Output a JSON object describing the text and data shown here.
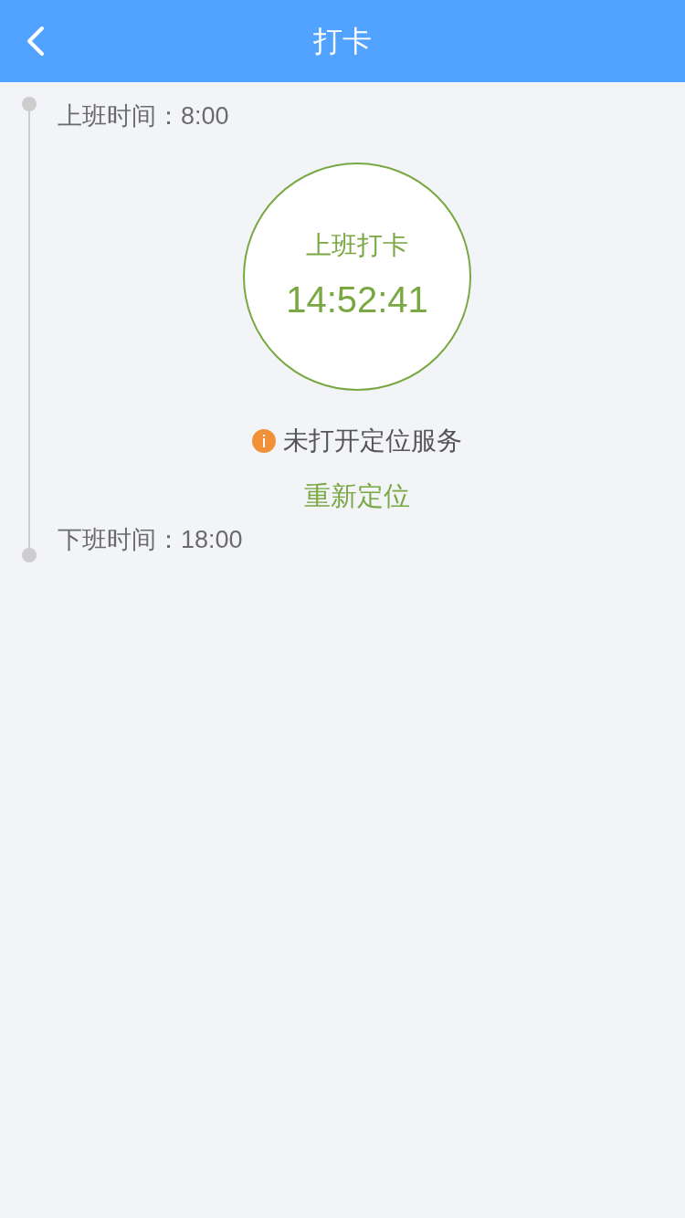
{
  "header": {
    "title": "打卡"
  },
  "timeline": [
    {
      "kind": "shift",
      "label": "上班时间：8:00"
    },
    {
      "kind": "punch",
      "title": "上班打卡",
      "time": "14:52:41",
      "notice": "未打开定位服务",
      "action": "重新定位"
    },
    {
      "kind": "shift",
      "label": "下班时间：18:00"
    }
  ]
}
